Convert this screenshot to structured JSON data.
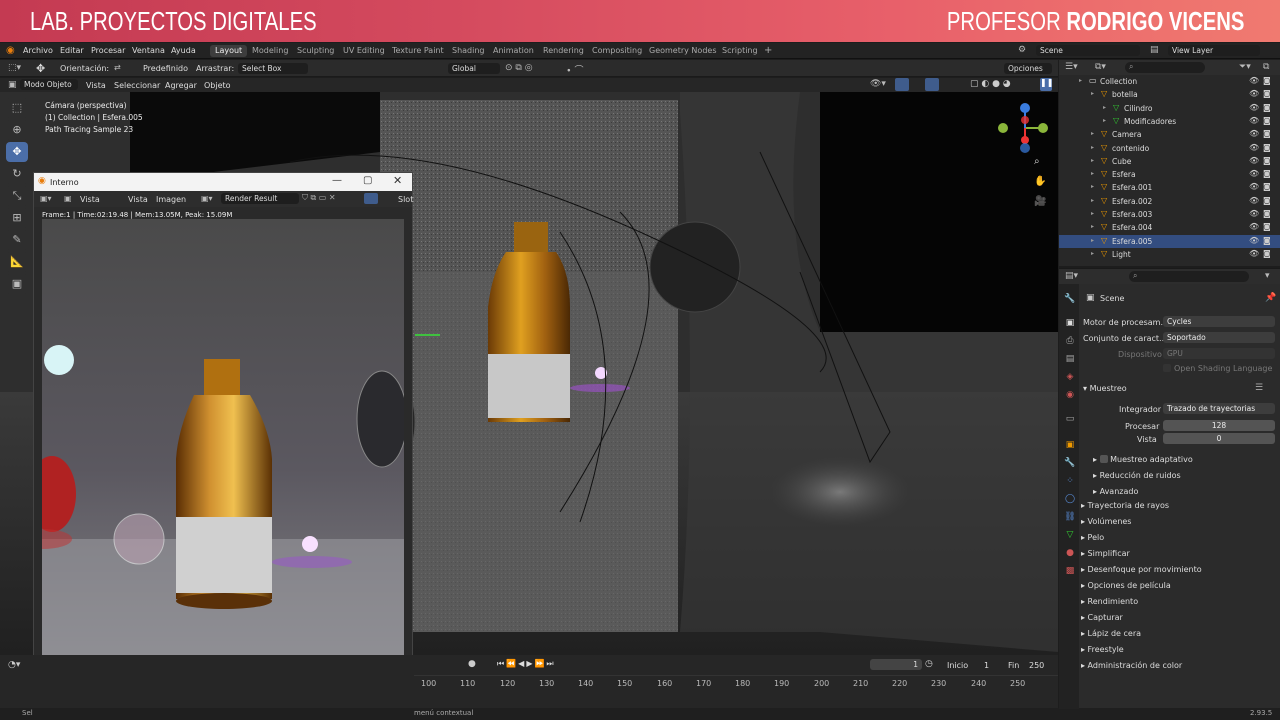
{
  "banner": {
    "left": "LAB. PROYECTOS DIGITALES",
    "right_prefix": "PROFESOR ",
    "right_name": "RODRIGO VICENS"
  },
  "menu": [
    "Archivo",
    "Editar",
    "Procesar",
    "Ventana",
    "Ayuda"
  ],
  "workspaces": [
    "Layout",
    "Modeling",
    "Sculpting",
    "UV Editing",
    "Texture Paint",
    "Shading",
    "Animation",
    "Rendering",
    "Compositing",
    "Geometry Nodes",
    "Scripting"
  ],
  "scene": "Scene",
  "view_layer": "View Layer",
  "toolbar": {
    "orientation_label": "Orientación:",
    "orientation_value": "Predefinido",
    "drag_label": "Arrastrar:",
    "drag_value": "Select Box",
    "transform": "Global",
    "options": "Opciones"
  },
  "header3": {
    "mode": "Modo Objeto",
    "items": [
      "Vista",
      "Seleccionar",
      "Agregar",
      "Objeto"
    ]
  },
  "overlay_info": [
    "Cámara (perspectiva)",
    "(1) Collection | Esfera.005",
    "Path Tracing Sample 23"
  ],
  "render_window": {
    "title": "Interno",
    "menu": [
      "Vista",
      "Vista",
      "Imagen"
    ],
    "image": "Render Result",
    "slot": "Slot",
    "info": "Frame:1 | Time:02:19.48 | Mem:13.05M, Peak: 15.09M"
  },
  "timeline": {
    "frame": "1",
    "start_label": "Inicio",
    "start": "1",
    "end_label": "Fin",
    "end": "250",
    "ticks": [
      "100",
      "110",
      "120",
      "130",
      "140",
      "150",
      "160",
      "170",
      "180",
      "190",
      "200",
      "210",
      "220",
      "230",
      "240",
      "250"
    ]
  },
  "status": {
    "left": "Sel",
    "middle": "menú contextual",
    "version": "2.93.5"
  },
  "outliner": {
    "rows": [
      {
        "name": "Collection",
        "indent": 0,
        "sel": false
      },
      {
        "name": "botella",
        "indent": 1,
        "sel": false
      },
      {
        "name": "Cilindro",
        "indent": 2,
        "sel": false
      },
      {
        "name": "Modificadores",
        "indent": 2,
        "sel": false
      },
      {
        "name": "Camera",
        "indent": 1,
        "sel": false
      },
      {
        "name": "contenido",
        "indent": 1,
        "sel": false
      },
      {
        "name": "Cube",
        "indent": 1,
        "sel": false
      },
      {
        "name": "Esfera",
        "indent": 1,
        "sel": false
      },
      {
        "name": "Esfera.001",
        "indent": 1,
        "sel": false
      },
      {
        "name": "Esfera.002",
        "indent": 1,
        "sel": false
      },
      {
        "name": "Esfera.003",
        "indent": 1,
        "sel": false
      },
      {
        "name": "Esfera.004",
        "indent": 1,
        "sel": false
      },
      {
        "name": "Esfera.005",
        "indent": 1,
        "sel": true
      },
      {
        "name": "Light",
        "indent": 1,
        "sel": false
      }
    ]
  },
  "properties": {
    "scene": "Scene",
    "engine_label": "Motor de procesam...",
    "engine": "Cycles",
    "featureset_label": "Conjunto de caract...",
    "featureset": "Soportado",
    "device_label": "Dispositivo",
    "device": "GPU",
    "osl": "Open Shading Language",
    "sampling": "Muestreo",
    "integrator_label": "Integrador",
    "integrator": "Trazado de trayectorias",
    "render_label": "Procesar",
    "render": "128",
    "viewport_label": "Vista",
    "viewport": "0",
    "adaptive": "Muestreo adaptativo",
    "denoise": "Reducción de ruidos",
    "advanced": "Avanzado",
    "panels": [
      "Trayectoria de rayos",
      "Volúmenes",
      "Pelo",
      "Simplificar",
      "Desenfoque por movimiento",
      "Opciones de película",
      "Rendimiento",
      "Capturar",
      "Lápiz de cera",
      "Freestyle",
      "Administración de color"
    ]
  }
}
